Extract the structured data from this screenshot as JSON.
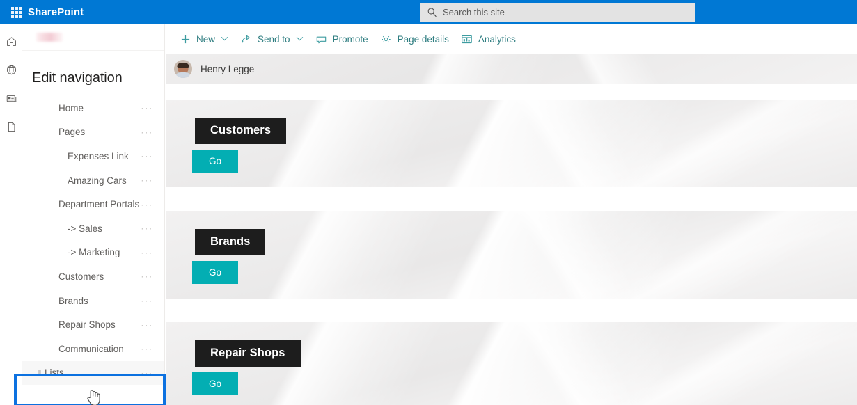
{
  "suite": {
    "brand": "SharePoint",
    "waffle_icon": "app-launcher-grid-icon",
    "search": {
      "placeholder": "Search this site",
      "value": "",
      "icon": "search-icon"
    },
    "header_color": "#0078d4"
  },
  "rail": {
    "items": [
      {
        "name": "home",
        "icon": "home-icon"
      },
      {
        "name": "globe",
        "icon": "globe-icon"
      },
      {
        "name": "news",
        "icon": "news-card-icon"
      },
      {
        "name": "files",
        "icon": "document-icon"
      }
    ]
  },
  "nav": {
    "title": "Edit navigation",
    "overflow_glyph": "···",
    "drag_handle_glyph": "‖",
    "items": [
      {
        "label": "Home",
        "level": 0,
        "selected": false
      },
      {
        "label": "Pages",
        "level": 0,
        "selected": false
      },
      {
        "label": "Expenses Link",
        "level": 1,
        "selected": false
      },
      {
        "label": "Amazing Cars",
        "level": 1,
        "selected": false
      },
      {
        "label": "Department Portals",
        "level": 0,
        "selected": false
      },
      {
        "label": "-> Sales",
        "level": 1,
        "selected": false
      },
      {
        "label": "-> Marketing",
        "level": 1,
        "selected": false
      },
      {
        "label": "Customers",
        "level": 0,
        "selected": false
      },
      {
        "label": "Brands",
        "level": 0,
        "selected": false
      },
      {
        "label": "Repair Shops",
        "level": 0,
        "selected": false
      },
      {
        "label": "Communication",
        "level": 0,
        "selected": false
      },
      {
        "label": "Lists",
        "level": 0,
        "selected": true
      }
    ],
    "focus_color": "#0c71e0"
  },
  "command_bar": {
    "accent_color": "#2e7d80",
    "items": [
      {
        "label": "New",
        "icon": "plus-icon",
        "has_caret": true
      },
      {
        "label": "Send to",
        "icon": "send-to-icon",
        "has_caret": true
      },
      {
        "label": "Promote",
        "icon": "promote-icon",
        "has_caret": false
      },
      {
        "label": "Page details",
        "icon": "gear-icon",
        "has_caret": false
      },
      {
        "label": "Analytics",
        "icon": "analytics-icon",
        "has_caret": false
      }
    ]
  },
  "author": {
    "name": "Henry Legge",
    "avatar": "user-photo-avatar"
  },
  "cards": {
    "go_label": "Go",
    "accent_color": "#03aeb3",
    "title_bg": "#1d1d1d",
    "items": [
      {
        "title": "Customers"
      },
      {
        "title": "Brands"
      },
      {
        "title": "Repair Shops"
      }
    ]
  }
}
